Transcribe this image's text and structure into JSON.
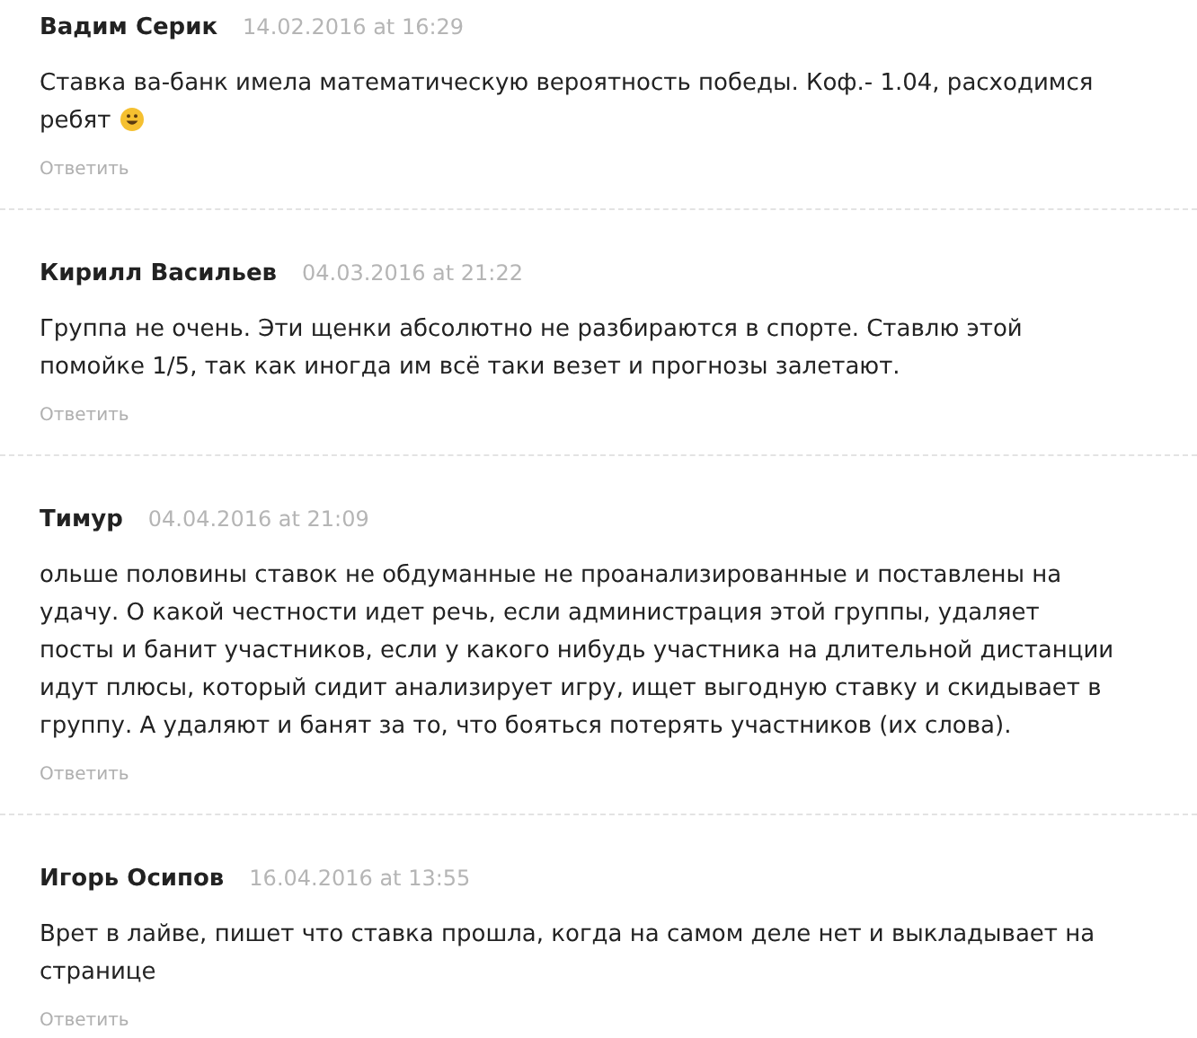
{
  "comments": [
    {
      "author": "Вадим Серик",
      "date": "14.02.2016 at 16:29",
      "text": "Ставка ва-банк имела математическую вероятность победы. Коф.- 1.04, расходимся ребят",
      "emoji": true,
      "reply": "Ответить"
    },
    {
      "author": "Кирилл Васильев",
      "date": "04.03.2016 at 21:22",
      "text": "Группа не очень. Эти щенки абсолютно не разбираются в спорте. Ставлю этой помойке 1/5, так как иногда им всё таки везет и прогнозы залетают.",
      "emoji": false,
      "reply": "Ответить"
    },
    {
      "author": "Тимур",
      "date": "04.04.2016 at 21:09",
      "text": "ольше половины ставок не обдуманные не проанализированные и поставлены на удачу. О какой честности идет речь, если администрация этой группы, удаляет посты и банит участников, если у какого нибудь участника на длительной дистанции идут плюсы, который сидит анализирует игру, ищет выгодную ставку и скидывает в группу. А удаляют и банят за то, что бояться потерять участников (их слова).",
      "emoji": false,
      "reply": "Ответить"
    },
    {
      "author": "Игорь Осипов",
      "date": "16.04.2016 at 13:55",
      "text": "Врет в лайве, пишет что ставка прошла, когда на самом деле нет и выкладывает на странице",
      "emoji": false,
      "reply": "Ответить"
    }
  ]
}
